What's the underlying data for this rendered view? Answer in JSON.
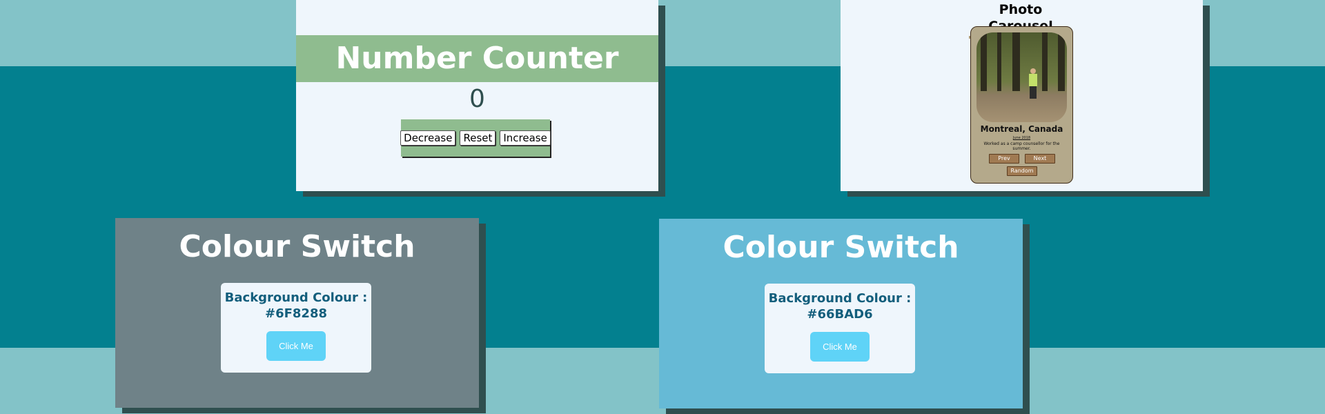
{
  "counter": {
    "title": "Number Counter",
    "value": "0",
    "buttons": {
      "decrease": "Decrease",
      "reset": "Reset",
      "increase": "Increase"
    }
  },
  "carousel": {
    "title": "Photo Carousel",
    "place": "Montreal, Canada",
    "date": "June 2018",
    "description": "Worked as a camp counsellor for the summer.",
    "buttons": {
      "prev": "Prev",
      "next": "Next",
      "random": "Random"
    }
  },
  "colour_switch": [
    {
      "title": "Colour Switch",
      "label_prefix": "Background Colour :",
      "hex": "#6F8288",
      "button": "Click Me"
    },
    {
      "title": "Colour Switch",
      "label_prefix": "Background Colour :",
      "hex": "#66BAD6",
      "button": "Click Me"
    }
  ],
  "colors": {
    "page_light": "#83c3c8",
    "page_dark": "#03808f",
    "counter_green": "#8fbc8f",
    "card_bg": "#eff6fc",
    "shadow": "#2f4f4f",
    "button_cyan": "#5fd3f7",
    "label_teal": "#135e7c"
  }
}
